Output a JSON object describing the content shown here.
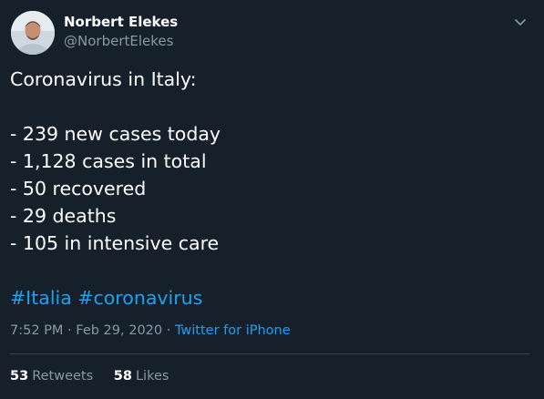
{
  "author": {
    "display_name": "Norbert Elekes",
    "handle": "@NorbertElekes"
  },
  "tweet": {
    "lines": [
      "Coronavirus in Italy:",
      "",
      "- 239 new cases today",
      "- 1,128 cases in total",
      "- 50 recovered",
      "- 29 deaths",
      "- 105 in intensive care",
      ""
    ],
    "hashtags": [
      "#Italia",
      "#coronavirus"
    ]
  },
  "meta": {
    "time": "7:52 PM",
    "separator": " · ",
    "date": "Feb 29, 2020",
    "source": "Twitter for iPhone"
  },
  "stats": {
    "retweets_count": "53",
    "retweets_label": "Retweets",
    "likes_count": "58",
    "likes_label": "Likes"
  },
  "colors": {
    "background": "#15202b",
    "text": "#ffffff",
    "secondary_text": "#8899a6",
    "link": "#1da1f2",
    "divider": "#38444d"
  },
  "icons": {
    "chevron": "chevron-down-icon"
  }
}
